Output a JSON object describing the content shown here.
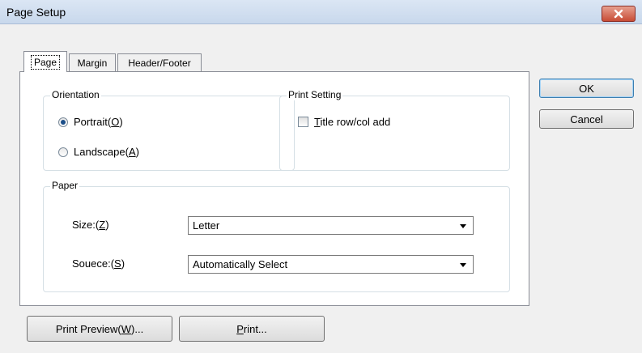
{
  "window": {
    "title": "Page Setup",
    "close_icon": "close-icon"
  },
  "tabs": [
    {
      "label": "Page",
      "active": true
    },
    {
      "label": "Margin",
      "active": false
    },
    {
      "label": "Header/Footer",
      "active": false
    }
  ],
  "orientation": {
    "title": "Orientation",
    "portrait": {
      "text": "Portrait(",
      "key": "O",
      "suffix": ")",
      "selected": true
    },
    "landscape": {
      "text": "Landscape(",
      "key": "A",
      "suffix": ")",
      "selected": false
    }
  },
  "print_setting": {
    "title": "Print Setting",
    "title_rowcol": {
      "key": "T",
      "text": "itle row/col add",
      "checked": false
    }
  },
  "paper": {
    "title": "Paper",
    "size_label": {
      "text": "Size:(",
      "key": "Z",
      "suffix": ")"
    },
    "size_value": "Letter",
    "source_label": {
      "text": "Souece:(",
      "key": "S",
      "suffix": ")"
    },
    "source_value": "Automatically Select"
  },
  "buttons": {
    "ok": "OK",
    "cancel": "Cancel",
    "print_preview": {
      "text": "Print Preview(",
      "key": "W",
      "suffix": ")..."
    },
    "print": {
      "key": "P",
      "text": "rint..."
    }
  },
  "colors": {
    "title_bar": "#cfdcee",
    "close_button": "#c84c36",
    "default_button_border": "#3c7fb1",
    "radio_dot": "#1c4f8a"
  }
}
